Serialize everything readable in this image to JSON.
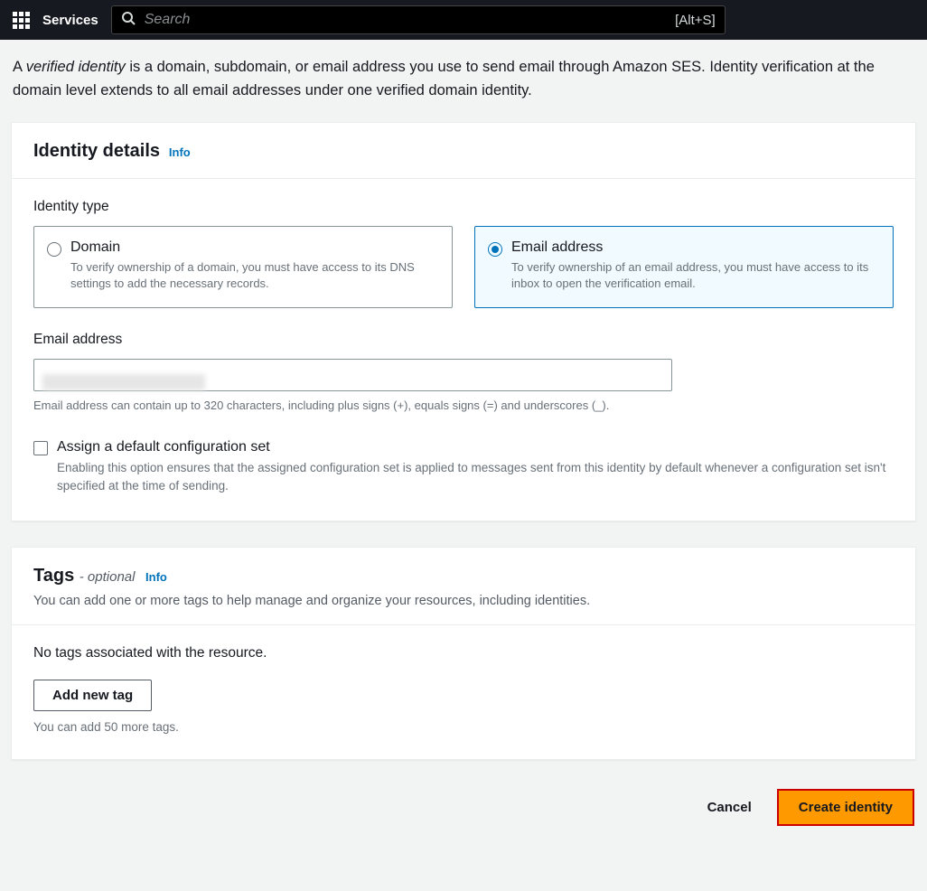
{
  "nav": {
    "services_label": "Services",
    "search_placeholder": "Search",
    "shortcut": "[Alt+S]"
  },
  "intro": {
    "lead_verified": "verified identity",
    "lead_prefix": "A ",
    "lead_rest": " is a domain, subdomain, or email address you use to send email through Amazon SES. Identity verification at the domain level extends to all email addresses under one verified domain identity."
  },
  "identity": {
    "panel_title": "Identity details",
    "info": "Info",
    "type_label": "Identity type",
    "domain": {
      "title": "Domain",
      "desc": "To verify ownership of a domain, you must have access to its DNS settings to add the necessary records."
    },
    "email": {
      "title": "Email address",
      "desc": "To verify ownership of an email address, you must have access to its inbox to open the verification email."
    },
    "email_label": "Email address",
    "email_hint": "Email address can contain up to 320 characters, including plus signs (+), equals signs (=) and underscores (_).",
    "assign_title": "Assign a default configuration set",
    "assign_desc": "Enabling this option ensures that the assigned configuration set is applied to messages sent from this identity by default whenever a configuration set isn't specified at the time of sending."
  },
  "tags": {
    "title": "Tags",
    "subtitle": "- optional",
    "info": "Info",
    "desc": "You can add one or more tags to help manage and organize your resources, including identities.",
    "empty": "No tags associated with the resource.",
    "add_button": "Add new tag",
    "limit": "You can add 50 more tags."
  },
  "actions": {
    "cancel": "Cancel",
    "create": "Create identity"
  }
}
